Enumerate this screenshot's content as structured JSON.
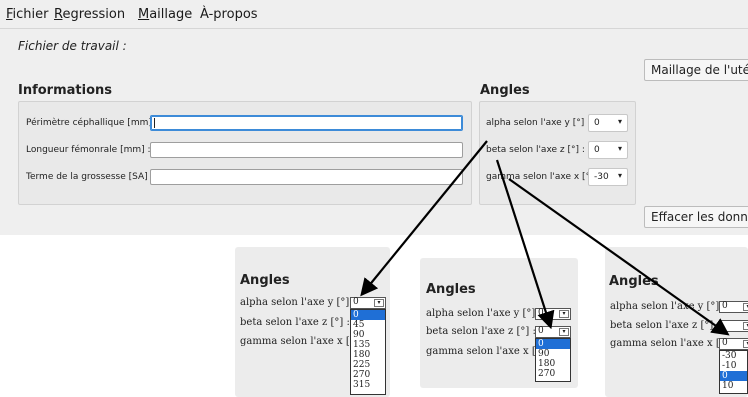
{
  "menu": {
    "fichier": {
      "mn": "F",
      "rest": "ichier"
    },
    "regression": {
      "mn": "R",
      "rest": "egression"
    },
    "maillage": {
      "mn": "M",
      "rest": "aillage"
    },
    "apropos": "À-propos"
  },
  "work_label": "Fichier de travail :",
  "buttons": {
    "maillage": "Maillage de l'utérus",
    "effacer": "Effacer les données"
  },
  "informations": {
    "title": "Informations",
    "fields": [
      {
        "label": "Périmètre céphallique [mm] :",
        "value": ""
      },
      {
        "label": "Longueur fémonrale [mm] :",
        "value": ""
      },
      {
        "label": "Terme de la grossesse [SA] :",
        "value": ""
      }
    ]
  },
  "angles": {
    "title": "Angles",
    "rows": [
      {
        "label": "alpha selon l'axe y [°] :",
        "value": "0"
      },
      {
        "label": "beta selon l'axe z [°] :",
        "value": "0"
      },
      {
        "label": "gamma selon l'axe x [°] :",
        "value": "-30"
      }
    ]
  },
  "zooms": [
    {
      "title": "Angles",
      "labels": [
        "alpha selon l'axe y [°] :",
        "beta selon l'axe z [°] :",
        "gamma selon l'axe x [°] :"
      ],
      "combo_value": "0",
      "options": [
        "0",
        "45",
        "90",
        "135",
        "180",
        "225",
        "270",
        "315"
      ],
      "selected_index": 0
    },
    {
      "title": "Angles",
      "labels": [
        "alpha selon l'axe y [°] :",
        "beta selon l'axe z [°] :",
        "gamma selon l'axe x [°] :"
      ],
      "combo_values": [
        "0",
        "0"
      ],
      "options": [
        "0",
        "90",
        "180",
        "270"
      ],
      "selected_index": 0
    },
    {
      "title": "Angles",
      "labels": [
        "alpha selon l'axe y [°] :",
        "beta selon l'axe z [°] :",
        "gamma selon l'axe x [°] :"
      ],
      "combo_values": [
        "0",
        "",
        "0"
      ],
      "options": [
        "-30",
        "-10",
        "0",
        "10"
      ],
      "selected_index": 2
    }
  ],
  "colors": {
    "accent": "#1f6fd6",
    "focus": "#3d8bd8",
    "background": "#efefef"
  }
}
